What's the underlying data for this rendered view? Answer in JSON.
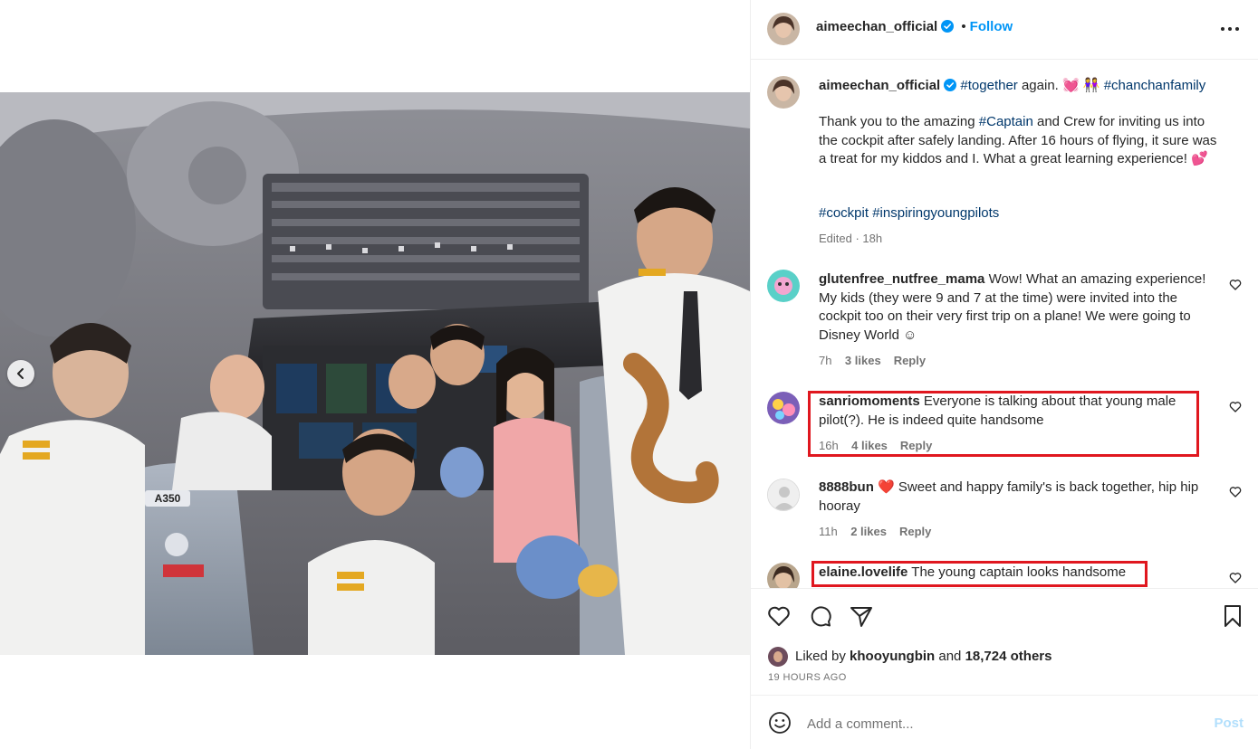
{
  "post": {
    "author": "aimeechan_official",
    "follow_label": "Follow",
    "more_icon": "more-horizontal-icon",
    "image_alt": "Family and flight crew posing in an Airbus A350 cockpit"
  },
  "caption": {
    "author": "aimeechan_official",
    "tag_together": "#together",
    "line1_text": " again. 💓 👭 ",
    "tag_chanchan": "#chanchanfamily",
    "body_pre": "Thank you to the amazing ",
    "tag_captain": "#Captain",
    "body_post": " and Crew for inviting us into the cockpit after safely landing. After 16 hours of flying, it sure was a treat for my kiddos and I. What a great learning experience! 💕",
    "tag_cockpit": "#cockpit",
    "tag_inspiring": "#inspiringyoungpilots",
    "edited": "Edited · 18h"
  },
  "comments": [
    {
      "user": "glutenfree_nutfree_mama",
      "text": " Wow! What an amazing experience! My kids (they were 9 and 7 at the time) were invited into the cockpit too on their very first trip on a plane! We were going to Disney World ☺",
      "time": "7h",
      "likes": "3 likes",
      "reply": "Reply"
    },
    {
      "user": "sanriomoments",
      "text": " Everyone is talking about that young male pilot(?). He is indeed quite handsome",
      "time": "16h",
      "likes": "4 likes",
      "reply": "Reply"
    },
    {
      "user": "8888bun",
      "text": " ❤️ Sweet and happy family's is back together, hip hip hooray",
      "time": "11h",
      "likes": "2 likes",
      "reply": "Reply"
    },
    {
      "user": "elaine.lovelife",
      "text": " The young captain looks handsome"
    }
  ],
  "actions": {
    "liked_by_prefix": "Liked by ",
    "liked_by_user": "khooyungbin",
    "liked_by_and": " and ",
    "liked_by_others": "18,724 others",
    "posted_ago": "19 HOURS AGO"
  },
  "composer": {
    "placeholder": "Add a comment...",
    "post_label": "Post"
  },
  "photo_labels": {
    "seat_badge": "A350"
  },
  "colors": {
    "link_blue": "#0095f6",
    "hashtag": "#00376b",
    "highlight_red": "#e0171f",
    "muted": "#737373"
  }
}
